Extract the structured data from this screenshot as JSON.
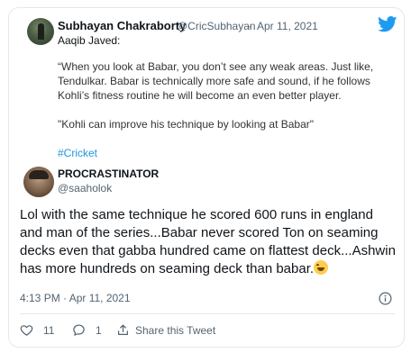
{
  "quoted": {
    "name": "Subhayan Chakraborty",
    "handle": "@CricSubhayan",
    "separator": "·",
    "date": "Apr 11, 2021",
    "line1": "Aaqib Javed:",
    "para1": "“When you look at Babar, you don’t see any weak areas. Just like, Tendulkar. Babar is technically more safe and sound, if he follows Kohli’s fitness routine he will become an even better player.",
    "para2": "\"Kohli can improve his technique by looking at Babar\"",
    "hashtag": "#Cricket"
  },
  "reply": {
    "name": "PROCRASTINATOR",
    "handle": "@saaholok",
    "text": "Lol with the same technique he scored 600 runs in england and man of the series...Babar never scored Ton on  seaming decks even that gabba hundred came on flattest deck...Ashwin has more hundreds on seaming deck than babar.",
    "emoji_icon": "joy-emoji",
    "time": "4:13 PM · Apr 11, 2021"
  },
  "actions": {
    "like_count": "11",
    "reply_count": "1",
    "share_label": "Share this Tweet"
  },
  "colors": {
    "twitter_blue": "#1d9bf0",
    "hashtag": "#1b95e0",
    "muted": "#536471"
  }
}
